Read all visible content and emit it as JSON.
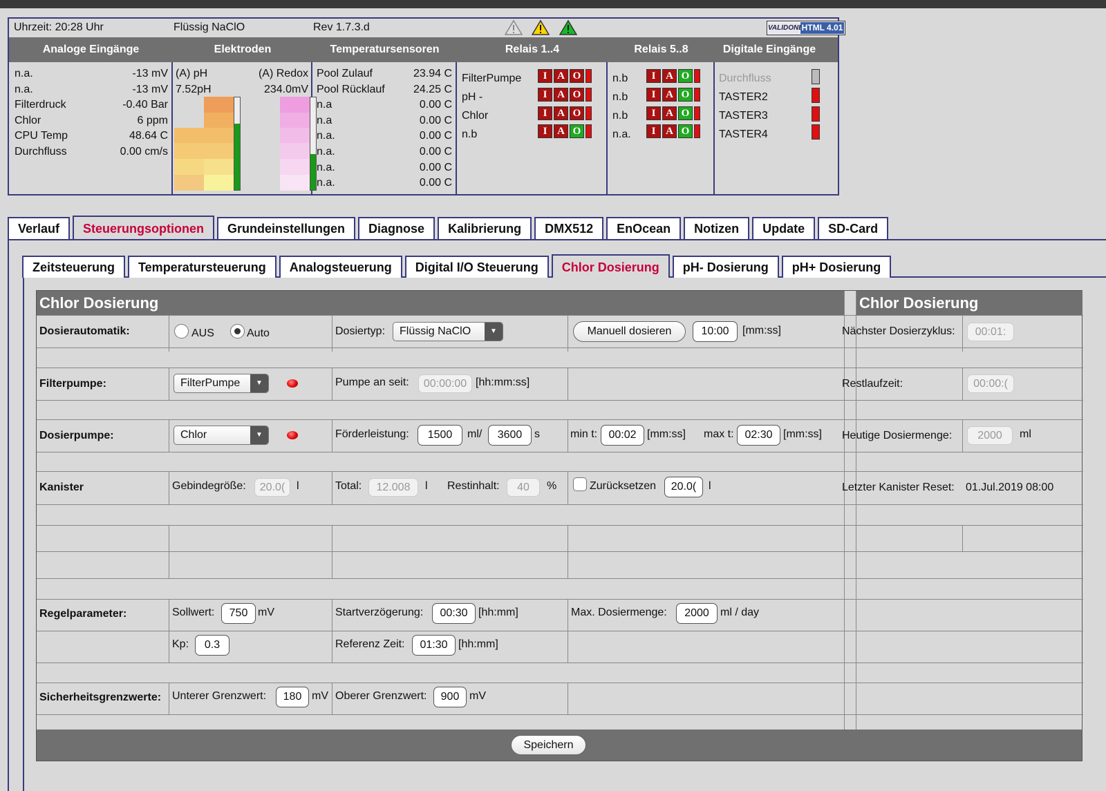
{
  "status": {
    "time": "Uhrzeit: 20:28 Uhr",
    "mode": "Flüssig NaClO",
    "rev": "Rev 1.7.3.d",
    "validone_a": "VALIDONE",
    "validone_b": "HTML 4.01",
    "headers": [
      "Analoge Eingänge",
      "Elektroden",
      "Temperatursensoren",
      "Relais 1..4",
      "Relais 5..8",
      "Digitale Eingänge"
    ],
    "analog": [
      {
        "name": "n.a.",
        "value": "-13 mV"
      },
      {
        "name": "n.a.",
        "value": "-13 mV"
      },
      {
        "name": "Filterdruck",
        "value": "-0.40 Bar"
      },
      {
        "name": "Chlor",
        "value": "6 ppm"
      },
      {
        "name": "CPU Temp",
        "value": "48.64 C"
      },
      {
        "name": "Durchfluss",
        "value": "0.00 cm/s"
      }
    ],
    "electrodes": {
      "ph_label": "(A) pH",
      "redox_label": "(A) Redox",
      "ph_value": "7.52pH",
      "redox_value": "234.0mV",
      "ph_level": 0.72,
      "redox_level": 0.39
    },
    "temps": [
      {
        "name": "Pool Zulauf",
        "value": "23.94 C"
      },
      {
        "name": "Pool Rücklauf",
        "value": "24.25 C"
      },
      {
        "name": "n.a",
        "value": "0.00 C"
      },
      {
        "name": "n.a",
        "value": "0.00 C"
      },
      {
        "name": "n.a.",
        "value": "0.00 C"
      },
      {
        "name": "n.a.",
        "value": "0.00 C"
      },
      {
        "name": "n.a.",
        "value": "0.00 C"
      },
      {
        "name": "n.a.",
        "value": "0.00 C"
      }
    ],
    "relays14": [
      "FilterPumpe",
      "pH -",
      "Chlor",
      "n.b"
    ],
    "relays58": [
      "n.b",
      "n.b",
      "n.b",
      "n.a."
    ],
    "iao": {
      "i": "I",
      "a": "A",
      "o": "O"
    },
    "digital": [
      "Durchfluss",
      "TASTER2",
      "TASTER3",
      "TASTER4"
    ]
  },
  "tabs": [
    "Verlauf",
    "Steuerungsoptionen",
    "Grundeinstellungen",
    "Diagnose",
    "Kalibrierung",
    "DMX512",
    "EnOcean",
    "Notizen",
    "Update",
    "SD-Card"
  ],
  "subtabs": [
    "Zeitsteuerung",
    "Temperatursteuerung",
    "Analogsteuerung",
    "Digital I/O Steuerung",
    "Chlor Dosierung",
    "pH- Dosierung",
    "pH+ Dosierung"
  ],
  "panel": {
    "title_left": "Chlor Dosierung",
    "title_right": "Chlor Dosierung",
    "dosierautomatik": "Dosierautomatik:",
    "aus": "AUS",
    "auto": "Auto",
    "dosiertyp": "Dosiertyp:",
    "dosiertyp_value": "Flüssig NaClO",
    "manuell_button": "Manuell dosieren",
    "manuell_time": "10:00",
    "mmss": "[mm:ss]",
    "naechster": "Nächster Dosierzyklus:",
    "naechster_value": "00:01:",
    "filterpumpe": "Filterpumpe:",
    "filterpumpe_value": "FilterPumpe",
    "pumpe_an_seit": "Pumpe an seit:",
    "pumpe_an_value": "00:00:00",
    "hhmmss": "[hh:mm:ss]",
    "restlaufzeit": "Restlaufzeit:",
    "restlaufzeit_value": "00:00:(",
    "dosierpumpe": "Dosierpumpe:",
    "dosierpumpe_value": "Chlor",
    "foerderleistung": "Förderleistung:",
    "foerder_ml": "1500",
    "ml_slash": "ml/",
    "foerder_s": "3600",
    "s": "s",
    "min_t": "min t:",
    "min_t_value": "00:02",
    "max_t": "max t:",
    "max_t_value": "02:30",
    "heutige": "Heutige Dosiermenge:",
    "heutige_value": "2000",
    "ml": "ml",
    "kanister": "Kanister",
    "gebinde": "Gebindegröße:",
    "gebinde_value": "20.0(",
    "l": "l",
    "total": "Total:",
    "total_value": "12.008",
    "restinhalt": "Restinhalt:",
    "restinhalt_value": "40",
    "percent": "%",
    "zuruecksetzen": "Zurücksetzen",
    "zuruecksetzen_value": "20.0(",
    "letzter": "Letzter Kanister Reset:",
    "letzter_value": "01.Jul.2019 08:00",
    "regelparameter": "Regelparameter:",
    "sollwert": "Sollwert:",
    "sollwert_value": "750",
    "mV": "mV",
    "startverz": "Startverzögerung:",
    "startverz_value": "00:30",
    "hhmm": "[hh:mm]",
    "maxdosier": "Max. Dosiermenge:",
    "maxdosier_value": "2000",
    "ml_day": "ml / day",
    "kp": "Kp:",
    "kp_value": "0.3",
    "refzeit": "Referenz Zeit:",
    "refzeit_value": "01:30",
    "sicherheit": "Sicherheitsgrenzwerte:",
    "unterer": "Unterer Grenzwert:",
    "unterer_value": "180",
    "oberer": "Oberer Grenzwert:",
    "oberer_value": "900",
    "speichern": "Speichern"
  },
  "colors": {
    "accent": "#c8003c",
    "header": "#707070",
    "border": "#3a3a80"
  }
}
